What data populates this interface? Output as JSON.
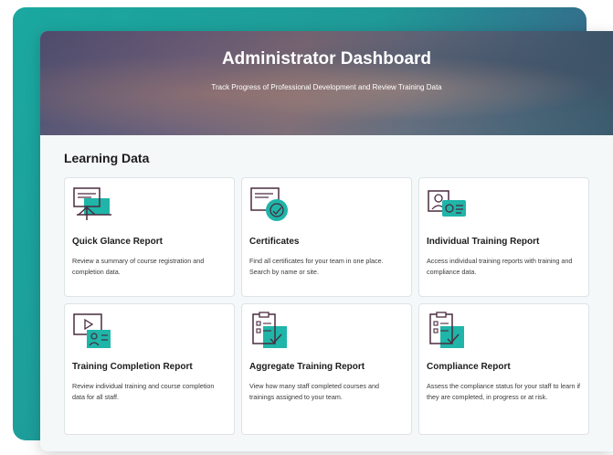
{
  "header": {
    "title": "Administrator Dashboard",
    "subtitle": "Track Progress of Professional Development and Review Training Data"
  },
  "section": {
    "title": "Learning Data"
  },
  "cards": [
    {
      "title": "Quick Glance Report",
      "description": "Review a summary of course registration and completion data.",
      "icon": "presentation-board-icon"
    },
    {
      "title": "Certificates",
      "description": "Find all certificates for your team in one place. Search by name or site.",
      "icon": "certificate-icon"
    },
    {
      "title": "Individual Training Report",
      "description": "Access individual training reports with training and compliance data.",
      "icon": "id-card-icon"
    },
    {
      "title": "Training Completion Report",
      "description": "Review individual training and course completion data for all staff.",
      "icon": "video-player-icon"
    },
    {
      "title": "Aggregate Training Report",
      "description": "View how many staff completed courses and trainings assigned to your team.",
      "icon": "checklist-icon"
    },
    {
      "title": "Compliance Report",
      "description": "Assess the compliance status for your staff to learn if they are completed, in progress or at risk.",
      "icon": "clipboard-check-icon"
    }
  ],
  "colors": {
    "accent": "#1fb5a8",
    "icon_outline": "#4a2b3e",
    "background": "#f5f8f9"
  }
}
